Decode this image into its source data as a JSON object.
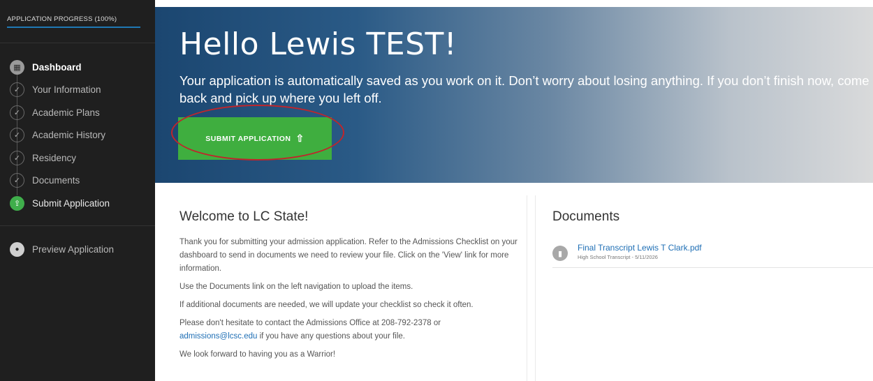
{
  "sidebar": {
    "progress_label": "APPLICATION PROGRESS (100%)",
    "progress_value": 1.0,
    "items": [
      {
        "label": "Dashboard",
        "icon": "dashboard-icon",
        "state": "active"
      },
      {
        "label": "Your Information",
        "icon": "check-icon",
        "state": "complete"
      },
      {
        "label": "Academic Plans",
        "icon": "check-icon",
        "state": "complete"
      },
      {
        "label": "Academic History",
        "icon": "check-icon",
        "state": "complete"
      },
      {
        "label": "Residency",
        "icon": "check-icon",
        "state": "complete"
      },
      {
        "label": "Documents",
        "icon": "check-icon",
        "state": "complete"
      },
      {
        "label": "Submit Application",
        "icon": "upload-icon",
        "state": "submit"
      }
    ],
    "preview_label": "Preview Application",
    "preview_icon": "eye-icon"
  },
  "hero": {
    "greeting": "Hello Lewis TEST!",
    "message": "Your application is automatically saved as you work on it. Don’t worry about losing anything. If you don’t finish now, come back and pick up where you left off.",
    "submit_label": "SUBMIT APPLICATION",
    "submit_icon": "upload-icon"
  },
  "welcome": {
    "title": "Welcome to LC State!",
    "para1": "Thank you for submitting your admission application. Refer to the Admissions Checklist on your dashboard to send in documents we need to review your file. Click on the 'View' link for more information.",
    "para2": "Use the Documents link on the left navigation to upload the items.",
    "para3": "If additional documents are needed, we will update your checklist so check it often.",
    "para4_before": "Please don't hesitate to contact the Admissions Office at 208-792-2378 or",
    "para4_link": "admissions@lcsc.edu",
    "para4_after": " if you have any questions about your file.",
    "para5": "We look forward to having you as a Warrior!"
  },
  "documents": {
    "title": "Documents",
    "items": [
      {
        "name": "Final Transcript Lewis T Clark.pdf",
        "subtitle": "High School Transcript - 5/11/2026",
        "icon": "document-icon"
      }
    ]
  },
  "colors": {
    "accent_green": "#3fae3f",
    "link_blue": "#1f6fb5",
    "annotation_red": "#c0252b",
    "sidebar_bg": "#1f1f1f"
  }
}
